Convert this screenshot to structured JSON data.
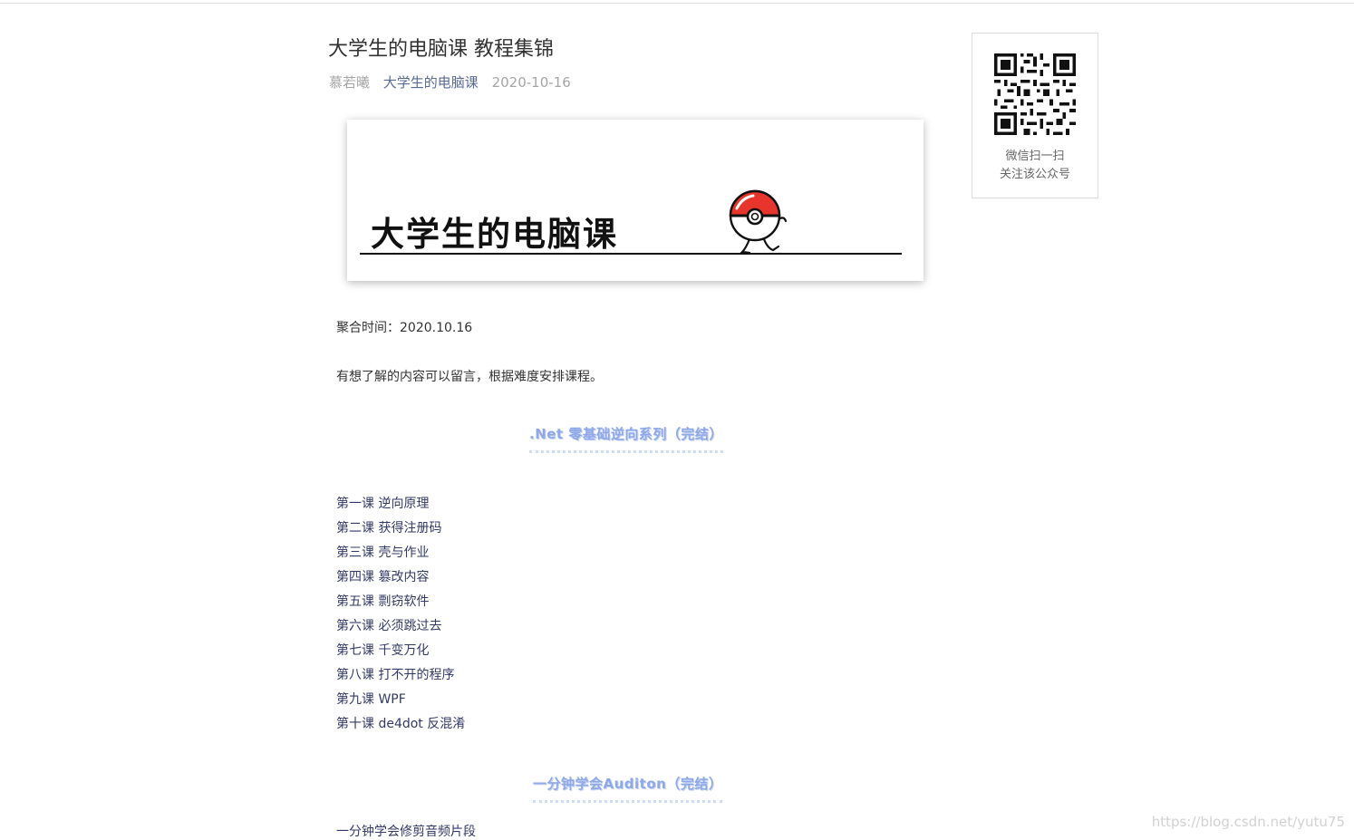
{
  "article": {
    "title": "大学生的电脑课 教程集锦",
    "author": "慕若曦",
    "account": "大学生的电脑课",
    "date": "2020-10-16"
  },
  "banner": {
    "text": "大学生的电脑课"
  },
  "body": {
    "aggregate_time": "聚合时间：2020.10.16",
    "intro": "有想了解的内容可以留言，根据难度安排课程。"
  },
  "sections": [
    {
      "heading": ".Net 零基础逆向系列（完结）",
      "items": [
        "第一课 逆向原理",
        "第二课 获得注册码",
        "第三课 壳与作业",
        "第四课 篡改内容",
        "第五课 剽窃软件",
        "第六课 必须跳过去",
        "第七课 千变万化",
        "第八课 打不开的程序",
        "第九课 WPF",
        "第十课 de4dot 反混淆"
      ]
    },
    {
      "heading": "一分钟学会Auditon（完结）",
      "items": [
        "一分钟学会修剪音频片段"
      ]
    }
  ],
  "qr": {
    "caption_line1": "微信扫一扫",
    "caption_line2": "关注该公众号",
    "icon": "qr-code-icon"
  },
  "watermark": "https://blog.csdn.net/yutu75",
  "colors": {
    "link": "#576b95",
    "heading_accent": "#8ea8e8",
    "pokeball_red": "#e8352b"
  }
}
